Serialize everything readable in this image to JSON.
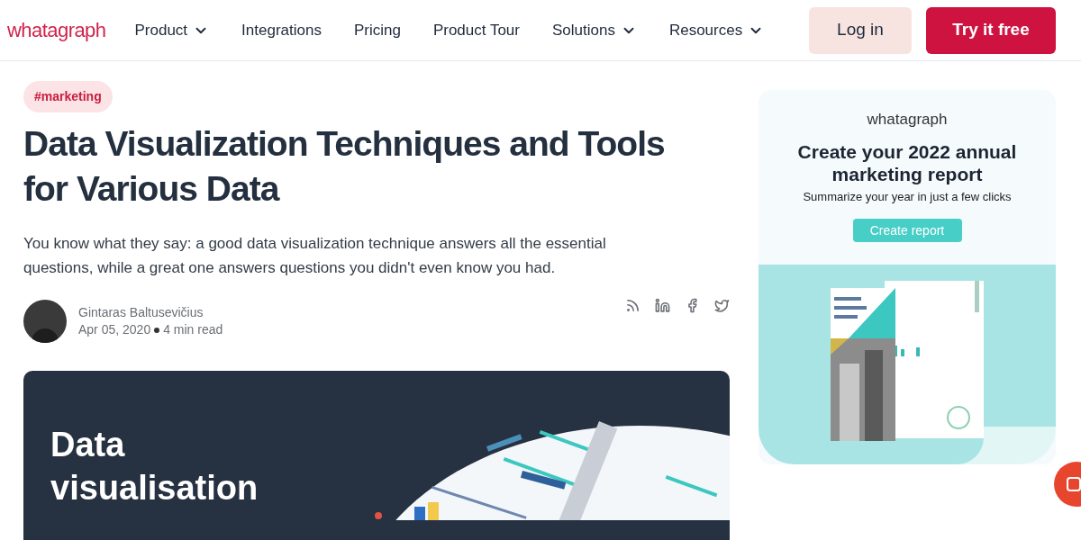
{
  "header": {
    "logo": "whatagraph",
    "nav": [
      {
        "label": "Product",
        "dropdown": true
      },
      {
        "label": "Integrations",
        "dropdown": false
      },
      {
        "label": "Pricing",
        "dropdown": false
      },
      {
        "label": "Product Tour",
        "dropdown": false
      },
      {
        "label": "Solutions",
        "dropdown": true
      },
      {
        "label": "Resources",
        "dropdown": true
      }
    ],
    "login": "Log in",
    "cta": "Try it free"
  },
  "article": {
    "tag": "#marketing",
    "title": "Data Visualization Techniques and Tools for Various Data",
    "lead": "You know what they say: a good data visualization technique answers all the essential questions, while a great one answers questions you didn't even know you had.",
    "author": "Gintaras Baltusevičius",
    "date": "Apr 05, 2020",
    "reading_time": "4 min read",
    "share": [
      {
        "kind": "rss"
      },
      {
        "kind": "linkedin"
      },
      {
        "kind": "facebook"
      },
      {
        "kind": "twitter"
      }
    ],
    "hero": {
      "heading": "Data visualisation"
    }
  },
  "ad": {
    "logo": "whatagraph",
    "title": "Create your 2022 annual marketing report",
    "subtitle": "Summarize your year in just a few clicks",
    "button": "Create report"
  }
}
